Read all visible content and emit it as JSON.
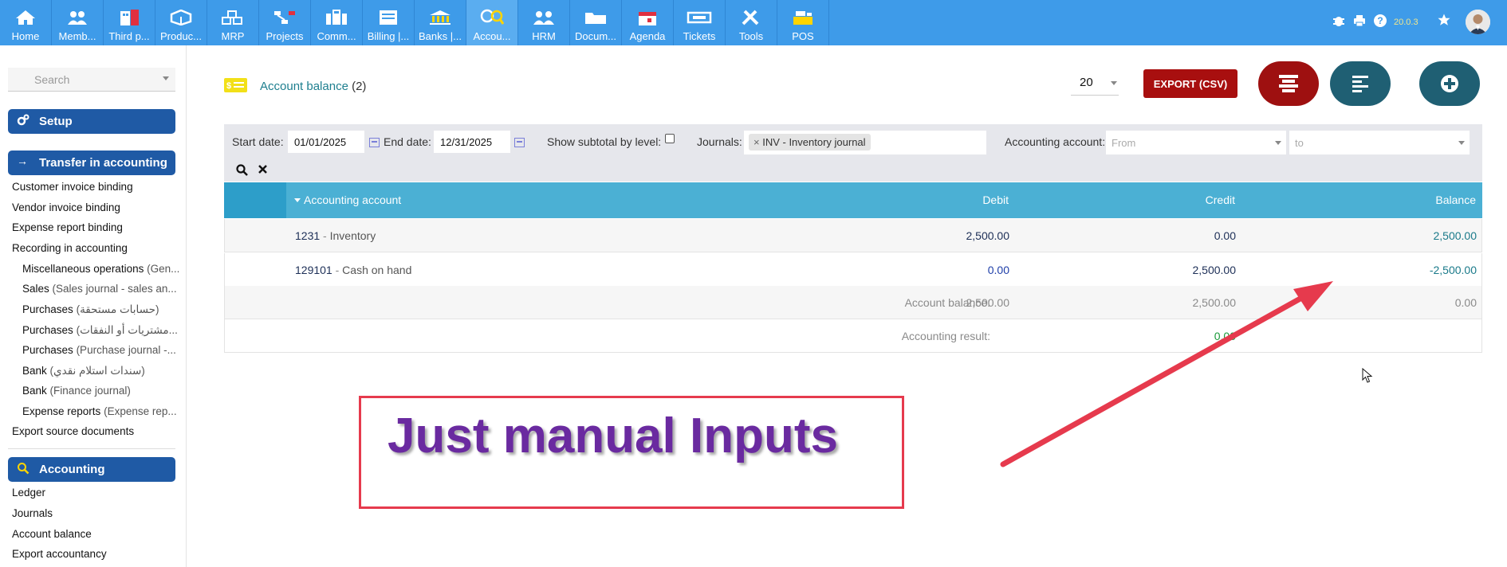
{
  "topbar": {
    "menus": [
      {
        "label": "Home",
        "icon": "home-icon"
      },
      {
        "label": "Memb...",
        "icon": "members-icon"
      },
      {
        "label": "Third p...",
        "icon": "building-icon"
      },
      {
        "label": "Produc...",
        "icon": "cube-icon"
      },
      {
        "label": "MRP",
        "icon": "cubes-icon"
      },
      {
        "label": "Projects",
        "icon": "sitemap-icon"
      },
      {
        "label": "Comm...",
        "icon": "suitcase-icon"
      },
      {
        "label": "Billing |...",
        "icon": "money-check-icon"
      },
      {
        "label": "Banks |...",
        "icon": "bank-icon"
      },
      {
        "label": "Accou...",
        "icon": "search-dollar-icon"
      },
      {
        "label": "HRM",
        "icon": "users-icon"
      },
      {
        "label": "Docum...",
        "icon": "folder-icon"
      },
      {
        "label": "Agenda",
        "icon": "calendar-icon"
      },
      {
        "label": "Tickets",
        "icon": "ticket-icon"
      },
      {
        "label": "Tools",
        "icon": "tools-icon"
      },
      {
        "label": "POS",
        "icon": "cash-register-icon"
      }
    ],
    "active_menu": "Accou...",
    "version": "20.0.3"
  },
  "sidebar": {
    "search_placeholder": "Search",
    "sections": {
      "setup": "Setup",
      "transfer": "Transfer in accounting",
      "accounting": "Accounting"
    },
    "transfer_items": [
      "Customer invoice binding",
      "Vendor invoice binding",
      "Expense report binding",
      "Recording in accounting"
    ],
    "journal_items": [
      {
        "name": "Miscellaneous operations",
        "detail": "(Gen..."
      },
      {
        "name": "Sales",
        "detail": "(Sales journal - sales an..."
      },
      {
        "name": "Purchases",
        "detail": "(حسابات مستحقة)"
      },
      {
        "name": "Purchases",
        "detail": "(مشتريات أو النفقات..."
      },
      {
        "name": "Purchases",
        "detail": "(Purchase journal -..."
      },
      {
        "name": "Bank",
        "detail": "(سندات استلام نقدي)"
      },
      {
        "name": "Bank",
        "detail": "(Finance journal)"
      },
      {
        "name": "Expense reports",
        "detail": "(Expense rep..."
      }
    ],
    "export_source": "Export source documents",
    "accounting_items": [
      "Ledger",
      "Journals",
      "Account balance",
      "Export accountancy"
    ]
  },
  "page": {
    "title": "Account balance",
    "count": "(2)",
    "page_size": "20",
    "export_label": "EXPORT (CSV)"
  },
  "filters": {
    "start_label": "Start date:",
    "start_value": "01/01/2025",
    "end_label": "End date:",
    "end_value": "12/31/2025",
    "subtotal_label": "Show subtotal by level:",
    "journals_label": "Journals:",
    "journal_tag": "INV - Inventory journal",
    "account_label": "Accounting account:",
    "from_placeholder": "From",
    "to_placeholder": "to"
  },
  "table": {
    "headers": {
      "account": "Accounting account",
      "debit": "Debit",
      "credit": "Credit",
      "balance": "Balance"
    },
    "rows": [
      {
        "code": "1231",
        "name": "Inventory",
        "debit": "2,500.00",
        "credit": "0.00",
        "balance": "2,500.00"
      },
      {
        "code": "129101",
        "name": "Cash on hand",
        "debit": "0.00",
        "credit": "2,500.00",
        "balance": "-2,500.00"
      }
    ],
    "totals": {
      "label": "Account balance:",
      "debit": "2,500.00",
      "credit": "2,500.00",
      "balance": "0.00"
    },
    "result": {
      "label": "Accounting result:",
      "value": "0.00"
    }
  },
  "annotation": {
    "text": "Just manual Inputs"
  },
  "colors": {
    "topbar": "#3e9be9",
    "sidebar_section": "#1f5aa5",
    "table_header": "#4bb0d4",
    "export": "#a80f0f",
    "annotation": "#e63a4d"
  }
}
